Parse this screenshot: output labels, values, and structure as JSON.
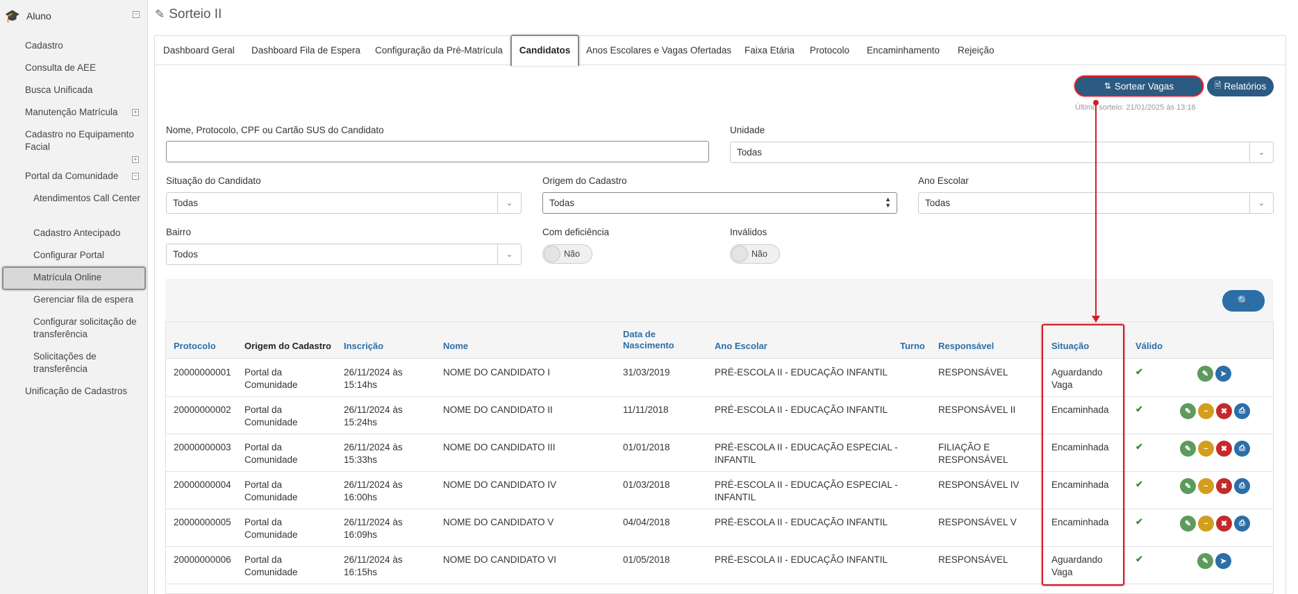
{
  "sidebar": {
    "header": "Aluno",
    "items": [
      {
        "label": "Cadastro"
      },
      {
        "label": "Consulta de AEE"
      },
      {
        "label": "Busca Unificada"
      },
      {
        "label": "Manutenção Matrícula"
      },
      {
        "label": "Cadastro no Equipamento Facial"
      },
      {
        "label": "Portal da Comunidade"
      },
      {
        "label": "Atendimentos Call Center"
      },
      {
        "label": "Cadastro Antecipado"
      },
      {
        "label": "Configurar Portal"
      },
      {
        "label": "Matrícula Online"
      },
      {
        "label": "Gerenciar fila de espera"
      },
      {
        "label": "Configurar solicitação de transferência"
      },
      {
        "label": "Solicitações de transferência"
      },
      {
        "label": "Unificação de Cadastros"
      }
    ]
  },
  "page": {
    "title": "Sorteio II"
  },
  "tabs": [
    {
      "label": "Dashboard Geral"
    },
    {
      "label": "Dashboard Fila de Espera"
    },
    {
      "label": "Configuração da Pré-Matrícula"
    },
    {
      "label": "Candidatos"
    },
    {
      "label": "Anos Escolares e Vagas Ofertadas"
    },
    {
      "label": "Faixa Etária"
    },
    {
      "label": "Protocolo"
    },
    {
      "label": "Encaminhamento"
    },
    {
      "label": "Rejeição"
    }
  ],
  "actions": {
    "sort_label": "Sortear Vagas",
    "reports_label": "Relatórios",
    "last_sort": "Último sorteio: 21/01/2025 às 13:16"
  },
  "filters": {
    "name_label": "Nome, Protocolo, CPF ou Cartão SUS do Candidato",
    "name_value": "",
    "unit_label": "Unidade",
    "unit_value": "Todas",
    "situation_label": "Situação do Candidato",
    "situation_value": "Todas",
    "origin_label": "Origem do Cadastro",
    "origin_value": "Todas",
    "year_label": "Ano Escolar",
    "year_value": "Todas",
    "district_label": "Bairro",
    "district_value": "Todos",
    "disability_label": "Com deficiência",
    "disability_value": "Não",
    "invalid_label": "Inválidos",
    "invalid_value": "Não"
  },
  "table": {
    "headers": {
      "protocolo": "Protocolo",
      "origem": "Origem do Cadastro",
      "inscricao": "Inscrição",
      "nome": "Nome",
      "nascimento_1": "Data de",
      "nascimento_2": "Nascimento",
      "ano": "Ano Escolar",
      "turno": "Turno",
      "responsavel": "Responsável",
      "situacao": "Situação",
      "valido": "Válido"
    },
    "rows": [
      {
        "protocolo": "20000000001",
        "origem_1": "Portal da",
        "origem_2": "Comunidade",
        "insc_1": "26/11/2024 às",
        "insc_2": "15:14hs",
        "nome": "NOME DO CANDIDATO I",
        "nasc": "31/03/2019",
        "ano_1": "PRÉ-ESCOLA II - EDUCAÇÃO INFANTIL",
        "ano_2": "",
        "resp_1": "RESPONSÁVEL",
        "resp_2": "",
        "sit_1": "Aguardando",
        "sit_2": "Vaga"
      },
      {
        "protocolo": "20000000002",
        "origem_1": "Portal da",
        "origem_2": "Comunidade",
        "insc_1": "26/11/2024 às",
        "insc_2": "15:24hs",
        "nome": "NOME DO CANDIDATO II",
        "nasc": "11/11/2018",
        "ano_1": "PRÉ-ESCOLA II - EDUCAÇÃO INFANTIL",
        "ano_2": "",
        "resp_1": "RESPONSÁVEL II",
        "resp_2": "",
        "sit_1": "Encaminhada",
        "sit_2": ""
      },
      {
        "protocolo": "20000000003",
        "origem_1": "Portal da",
        "origem_2": "Comunidade",
        "insc_1": "26/11/2024 às",
        "insc_2": "15:33hs",
        "nome": "NOME DO CANDIDATO III",
        "nasc": "01/01/2018",
        "ano_1": "PRÉ-ESCOLA II - EDUCAÇÃO ESPECIAL -",
        "ano_2": "INFANTIL",
        "resp_1": "FILIAÇÃO E",
        "resp_2": "RESPONSÁVEL",
        "sit_1": "Encaminhada",
        "sit_2": ""
      },
      {
        "protocolo": "20000000004",
        "origem_1": "Portal da",
        "origem_2": "Comunidade",
        "insc_1": "26/11/2024 às",
        "insc_2": "16:00hs",
        "nome": "NOME DO CANDIDATO IV",
        "nasc": "01/03/2018",
        "ano_1": "PRÉ-ESCOLA II - EDUCAÇÃO ESPECIAL -",
        "ano_2": "INFANTIL",
        "resp_1": "RESPONSÁVEL IV",
        "resp_2": "",
        "sit_1": "Encaminhada",
        "sit_2": ""
      },
      {
        "protocolo": "20000000005",
        "origem_1": "Portal da",
        "origem_2": "Comunidade",
        "insc_1": "26/11/2024 às",
        "insc_2": "16:09hs",
        "nome": "NOME DO CANDIDATO V",
        "nasc": "04/04/2018",
        "ano_1": "PRÉ-ESCOLA II - EDUCAÇÃO INFANTIL",
        "ano_2": "",
        "resp_1": "RESPONSÁVEL V",
        "resp_2": "",
        "sit_1": "Encaminhada",
        "sit_2": ""
      },
      {
        "protocolo": "20000000006",
        "origem_1": "Portal da",
        "origem_2": "Comunidade",
        "insc_1": "26/11/2024 às",
        "insc_2": "16:15hs",
        "nome": "NOME DO CANDIDATO VI",
        "nasc": "01/05/2018",
        "ano_1": "PRÉ-ESCOLA II - EDUCAÇÃO INFANTIL",
        "ano_2": "",
        "resp_1": "RESPONSÁVEL",
        "resp_2": "",
        "sit_1": "Aguardando",
        "sit_2": "Vaga"
      }
    ]
  },
  "colors": {
    "accent": "#2b6ea8",
    "highlight": "#d11f2a",
    "valid": "#3a8a3a"
  }
}
